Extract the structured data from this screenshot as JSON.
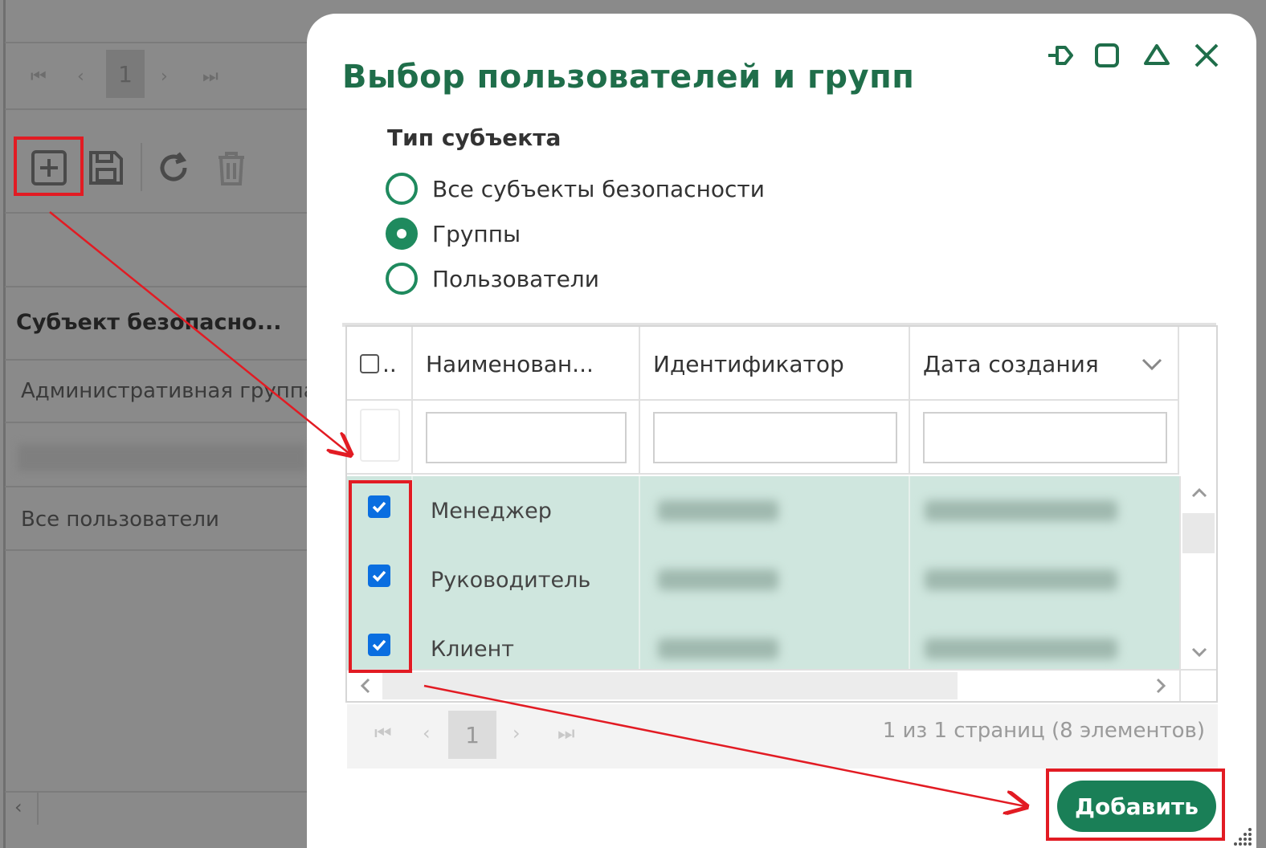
{
  "background": {
    "pager_page": "1",
    "column_header": "Субъект безопасно...",
    "rows": [
      "Административная группа",
      "Все пользователи"
    ],
    "toolbar_icons": [
      "add-icon",
      "save-icon",
      "refresh-icon",
      "delete-icon"
    ]
  },
  "dialog": {
    "title": "Выбор пользователей и групп",
    "window_icons": [
      "pin-icon",
      "maximize-icon",
      "collapse-icon",
      "close-icon"
    ],
    "subject_type_label": "Тип субъекта",
    "radio_options": [
      {
        "label": "Все субъекты безопасности",
        "selected": false
      },
      {
        "label": "Группы",
        "selected": true
      },
      {
        "label": "Пользователи",
        "selected": false
      }
    ],
    "grid": {
      "headers": {
        "select": "..",
        "name": "Наименован...",
        "id": "Идентификатор",
        "created": "Дата создания"
      },
      "rows": [
        {
          "name": "Менеджер",
          "checked": true
        },
        {
          "name": "Руководитель",
          "checked": true
        },
        {
          "name": "Клиент",
          "checked": true
        }
      ]
    },
    "pager": {
      "page": "1",
      "info": "1 из 1 страниц (8 элементов)"
    },
    "add_button": "Добавить"
  },
  "colors": {
    "accent": "#1a7f57",
    "title": "#1f6e4a",
    "row_selected": "#cfe6de",
    "checkbox": "#0a6ee0",
    "annotation": "#e21b23"
  }
}
